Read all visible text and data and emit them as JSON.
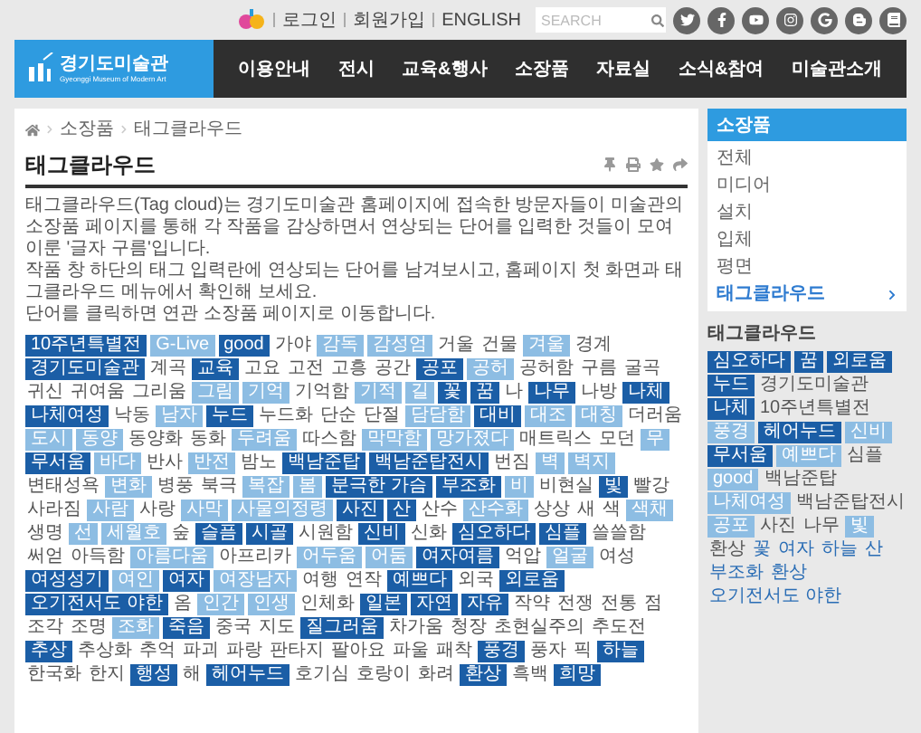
{
  "top_links": [
    "로그인",
    "회원가입",
    "ENGLISH"
  ],
  "search": {
    "placeholder": "SEARCH"
  },
  "logo": {
    "name": "경기도미술관",
    "subtitle": "Gyeonggi Museum of Modern Art"
  },
  "nav": [
    "이용안내",
    "전시",
    "교육&행사",
    "소장품",
    "자료실",
    "소식&참여",
    "미술관소개"
  ],
  "breadcrumb": [
    "소장품",
    "태그클라우드"
  ],
  "page_title": "태그클라우드",
  "description": [
    "태그클라우드(Tag cloud)는 경기도미술관 홈페이지에 접속한 방문자들이 미술관의 소장품 페이지를 통해 각 작품을 감상하면서 연상되는 단어를 입력한 것들이 모여 이룬 '글자 구름'입니다.",
    "작품 창 하단의 태그 입력란에 연상되는 단어를 남겨보시고, 홈페이지 첫 화면과 태그클라우드 메뉴에서 확인해 보세요.",
    "단어를 클릭하면 연관 소장품 페이지로 이동합니다."
  ],
  "tags": [
    {
      "label": "10주년특별전",
      "kind": "dark"
    },
    {
      "label": "G-Live",
      "kind": "light"
    },
    {
      "label": "good",
      "kind": "dark"
    },
    {
      "label": "가야",
      "kind": "plain"
    },
    {
      "label": "감독",
      "kind": "light"
    },
    {
      "label": "감성엄",
      "kind": "light"
    },
    {
      "label": "거울",
      "kind": "plain"
    },
    {
      "label": "건물",
      "kind": "plain"
    },
    {
      "label": "겨울",
      "kind": "light"
    },
    {
      "label": "경계",
      "kind": "plain"
    },
    {
      "label": "경기도미술관",
      "kind": "dark"
    },
    {
      "label": "계곡",
      "kind": "plain"
    },
    {
      "label": "교육",
      "kind": "dark"
    },
    {
      "label": "고요",
      "kind": "plain"
    },
    {
      "label": "고전",
      "kind": "plain"
    },
    {
      "label": "고흥",
      "kind": "plain"
    },
    {
      "label": "공간",
      "kind": "plain"
    },
    {
      "label": "공포",
      "kind": "dark"
    },
    {
      "label": "공허",
      "kind": "light"
    },
    {
      "label": "공허함",
      "kind": "plain"
    },
    {
      "label": "구름",
      "kind": "plain"
    },
    {
      "label": "굴곡",
      "kind": "plain"
    },
    {
      "label": "귀신",
      "kind": "plain"
    },
    {
      "label": "귀여움",
      "kind": "plain"
    },
    {
      "label": "그리움",
      "kind": "plain"
    },
    {
      "label": "그림",
      "kind": "light"
    },
    {
      "label": "기억",
      "kind": "light"
    },
    {
      "label": "기억함",
      "kind": "plain"
    },
    {
      "label": "기적",
      "kind": "light"
    },
    {
      "label": "길",
      "kind": "light"
    },
    {
      "label": "꽃",
      "kind": "dark"
    },
    {
      "label": "꿈",
      "kind": "dark"
    },
    {
      "label": "나",
      "kind": "plain"
    },
    {
      "label": "나무",
      "kind": "dark"
    },
    {
      "label": "나방",
      "kind": "plain"
    },
    {
      "label": "나체",
      "kind": "dark"
    },
    {
      "label": "나체여성",
      "kind": "dark"
    },
    {
      "label": "낙동",
      "kind": "plain"
    },
    {
      "label": "남자",
      "kind": "light"
    },
    {
      "label": "누드",
      "kind": "dark"
    },
    {
      "label": "누드화",
      "kind": "plain"
    },
    {
      "label": "단순",
      "kind": "plain"
    },
    {
      "label": "단절",
      "kind": "plain"
    },
    {
      "label": "담담함",
      "kind": "light"
    },
    {
      "label": "대비",
      "kind": "dark"
    },
    {
      "label": "대조",
      "kind": "light"
    },
    {
      "label": "대칭",
      "kind": "light"
    },
    {
      "label": "더러움",
      "kind": "plain"
    },
    {
      "label": "도시",
      "kind": "light"
    },
    {
      "label": "동양",
      "kind": "light"
    },
    {
      "label": "동양화",
      "kind": "plain"
    },
    {
      "label": "동화",
      "kind": "plain"
    },
    {
      "label": "두려움",
      "kind": "light"
    },
    {
      "label": "따스함",
      "kind": "plain"
    },
    {
      "label": "막막함",
      "kind": "light"
    },
    {
      "label": "망가졌다",
      "kind": "light"
    },
    {
      "label": "매트릭스",
      "kind": "plain"
    },
    {
      "label": "모던",
      "kind": "plain"
    },
    {
      "label": "무",
      "kind": "light"
    },
    {
      "label": "무서움",
      "kind": "dark"
    },
    {
      "label": "바다",
      "kind": "light"
    },
    {
      "label": "반사",
      "kind": "plain"
    },
    {
      "label": "반전",
      "kind": "light"
    },
    {
      "label": "밤노",
      "kind": "plain"
    },
    {
      "label": "백남준탑",
      "kind": "dark"
    },
    {
      "label": "백남준탑전시",
      "kind": "dark"
    },
    {
      "label": "번짐",
      "kind": "plain"
    },
    {
      "label": "벽",
      "kind": "light"
    },
    {
      "label": "벽지",
      "kind": "light"
    },
    {
      "label": "변태성욕",
      "kind": "plain"
    },
    {
      "label": "변화",
      "kind": "light"
    },
    {
      "label": "병풍",
      "kind": "plain"
    },
    {
      "label": "북극",
      "kind": "plain"
    },
    {
      "label": "복잡",
      "kind": "light"
    },
    {
      "label": "봄",
      "kind": "light"
    },
    {
      "label": "분극한 가슴",
      "kind": "dark"
    },
    {
      "label": "부조화",
      "kind": "dark"
    },
    {
      "label": "비",
      "kind": "light"
    },
    {
      "label": "비현실",
      "kind": "plain"
    },
    {
      "label": "빛",
      "kind": "dark"
    },
    {
      "label": "빨강",
      "kind": "plain"
    },
    {
      "label": "사라짐",
      "kind": "plain"
    },
    {
      "label": "사람",
      "kind": "light"
    },
    {
      "label": "사랑",
      "kind": "plain"
    },
    {
      "label": "사막",
      "kind": "light"
    },
    {
      "label": "사물의정령",
      "kind": "light"
    },
    {
      "label": "사진",
      "kind": "dark"
    },
    {
      "label": "산",
      "kind": "dark"
    },
    {
      "label": "산수",
      "kind": "plain"
    },
    {
      "label": "산수화",
      "kind": "light"
    },
    {
      "label": "상상",
      "kind": "plain"
    },
    {
      "label": "새",
      "kind": "plain"
    },
    {
      "label": "색",
      "kind": "plain"
    },
    {
      "label": "색채",
      "kind": "light"
    },
    {
      "label": "생명",
      "kind": "plain"
    },
    {
      "label": "선",
      "kind": "light"
    },
    {
      "label": "세월호",
      "kind": "light"
    },
    {
      "label": "숲",
      "kind": "plain"
    },
    {
      "label": "슬픔",
      "kind": "dark"
    },
    {
      "label": "시골",
      "kind": "dark"
    },
    {
      "label": "시원함",
      "kind": "plain"
    },
    {
      "label": "신비",
      "kind": "dark"
    },
    {
      "label": "신화",
      "kind": "plain"
    },
    {
      "label": "심오하다",
      "kind": "dark"
    },
    {
      "label": "심플",
      "kind": "dark"
    },
    {
      "label": "쓸쓸함",
      "kind": "plain"
    },
    {
      "label": "써얻",
      "kind": "plain"
    },
    {
      "label": "아득함",
      "kind": "plain"
    },
    {
      "label": "아름다움",
      "kind": "light"
    },
    {
      "label": "아프리카",
      "kind": "plain"
    },
    {
      "label": "어두움",
      "kind": "light"
    },
    {
      "label": "어둠",
      "kind": "light"
    },
    {
      "label": "여자여름",
      "kind": "dark"
    },
    {
      "label": "억압",
      "kind": "plain"
    },
    {
      "label": "얼굴",
      "kind": "light"
    },
    {
      "label": "여성",
      "kind": "plain"
    },
    {
      "label": "여성성기",
      "kind": "dark"
    },
    {
      "label": "여인",
      "kind": "light"
    },
    {
      "label": "여자",
      "kind": "dark"
    },
    {
      "label": "여장남자",
      "kind": "light"
    },
    {
      "label": "여행",
      "kind": "plain"
    },
    {
      "label": "연작",
      "kind": "plain"
    },
    {
      "label": "예쁘다",
      "kind": "dark"
    },
    {
      "label": "외국",
      "kind": "plain"
    },
    {
      "label": "외로움",
      "kind": "dark"
    },
    {
      "label": "오기전서도 야한",
      "kind": "dark"
    },
    {
      "label": "옴",
      "kind": "plain"
    },
    {
      "label": "인간",
      "kind": "light"
    },
    {
      "label": "인생",
      "kind": "light"
    },
    {
      "label": "인체화",
      "kind": "plain"
    },
    {
      "label": "일본",
      "kind": "dark"
    },
    {
      "label": "자연",
      "kind": "dark"
    },
    {
      "label": "자유",
      "kind": "dark"
    },
    {
      "label": "작약",
      "kind": "plain"
    },
    {
      "label": "전쟁",
      "kind": "plain"
    },
    {
      "label": "전통",
      "kind": "plain"
    },
    {
      "label": "점",
      "kind": "plain"
    },
    {
      "label": "조각",
      "kind": "plain"
    },
    {
      "label": "조명",
      "kind": "plain"
    },
    {
      "label": "조화",
      "kind": "light"
    },
    {
      "label": "죽음",
      "kind": "dark"
    },
    {
      "label": "중국",
      "kind": "plain"
    },
    {
      "label": "지도",
      "kind": "plain"
    },
    {
      "label": "질그러움",
      "kind": "dark"
    },
    {
      "label": "차가움",
      "kind": "plain"
    },
    {
      "label": "청장",
      "kind": "plain"
    },
    {
      "label": "초현실주의",
      "kind": "plain"
    },
    {
      "label": "추도전",
      "kind": "plain"
    },
    {
      "label": "추상",
      "kind": "dark"
    },
    {
      "label": "추상화",
      "kind": "plain"
    },
    {
      "label": "추억",
      "kind": "plain"
    },
    {
      "label": "파괴",
      "kind": "plain"
    },
    {
      "label": "파랑",
      "kind": "plain"
    },
    {
      "label": "판타지",
      "kind": "plain"
    },
    {
      "label": "팔아요",
      "kind": "plain"
    },
    {
      "label": "파울",
      "kind": "plain"
    },
    {
      "label": "패착",
      "kind": "plain"
    },
    {
      "label": "풍경",
      "kind": "dark"
    },
    {
      "label": "풍자",
      "kind": "plain"
    },
    {
      "label": "픽",
      "kind": "plain"
    },
    {
      "label": "하늘",
      "kind": "dark"
    },
    {
      "label": "한국화",
      "kind": "plain"
    },
    {
      "label": "한지",
      "kind": "plain"
    },
    {
      "label": "행성",
      "kind": "dark"
    },
    {
      "label": "해",
      "kind": "plain"
    },
    {
      "label": "헤어누드",
      "kind": "dark"
    },
    {
      "label": "호기심",
      "kind": "plain"
    },
    {
      "label": "호랑이",
      "kind": "plain"
    },
    {
      "label": "화려",
      "kind": "plain"
    },
    {
      "label": "환상",
      "kind": "dark"
    },
    {
      "label": "흑백",
      "kind": "plain"
    },
    {
      "label": "희망",
      "kind": "dark"
    }
  ],
  "sidebar": {
    "title": "소장품",
    "items": [
      {
        "label": "전체",
        "selected": false
      },
      {
        "label": "미디어",
        "selected": false
      },
      {
        "label": "설치",
        "selected": false
      },
      {
        "label": "입체",
        "selected": false
      },
      {
        "label": "평면",
        "selected": false
      },
      {
        "label": "태그클라우드",
        "selected": true
      }
    ]
  },
  "sidebar_tags": {
    "title": "태그클라우드",
    "tags": [
      {
        "label": "심오하다",
        "kind": "dark"
      },
      {
        "label": "꿈",
        "kind": "dark"
      },
      {
        "label": "외로움",
        "kind": "dark"
      },
      {
        "label": "누드",
        "kind": "dark"
      },
      {
        "label": "경기도미술관",
        "kind": "plain"
      },
      {
        "label": "나체",
        "kind": "dark"
      },
      {
        "label": "10주년특별전",
        "kind": "plain"
      },
      {
        "label": "풍경",
        "kind": "light"
      },
      {
        "label": "헤어누드",
        "kind": "dark"
      },
      {
        "label": "신비",
        "kind": "light"
      },
      {
        "label": "무서움",
        "kind": "dark"
      },
      {
        "label": "예쁘다",
        "kind": "light"
      },
      {
        "label": "심플",
        "kind": "plain"
      },
      {
        "label": "good",
        "kind": "light"
      },
      {
        "label": "백남준탑",
        "kind": "plain"
      },
      {
        "label": "나체여성",
        "kind": "light"
      },
      {
        "label": "백남준탑전시",
        "kind": "plain"
      },
      {
        "label": "공포",
        "kind": "light"
      },
      {
        "label": "사진",
        "kind": "plain"
      },
      {
        "label": "나무",
        "kind": "plain"
      },
      {
        "label": "빛",
        "kind": "light"
      },
      {
        "label": "환상",
        "kind": "plain"
      },
      {
        "label": "꽃",
        "kind": "link"
      },
      {
        "label": "여자",
        "kind": "link"
      },
      {
        "label": "하늘",
        "kind": "link"
      },
      {
        "label": "산",
        "kind": "link"
      },
      {
        "label": "부조화",
        "kind": "link"
      },
      {
        "label": "환상",
        "kind": "link"
      },
      {
        "label": "오기전서도 야한",
        "kind": "link"
      }
    ]
  }
}
